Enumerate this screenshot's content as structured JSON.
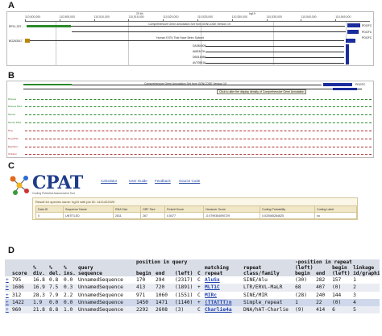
{
  "panels": {
    "a": {
      "letter": "A",
      "ruler": [
        "110,500,000",
        "110,505,000",
        "110,510,000",
        "110,515,000",
        "110,520,000",
        "110,525,000",
        "110,530,000",
        "110,535,000",
        "110,540,000",
        "110,545,000"
      ],
      "scale": "20 kb",
      "scale_label": "hg19",
      "track_title_1": "Comprehensive Gene Annotation Set from GENCODE Version 19",
      "track_title_2": "Human ESTs That Have Been Spliced",
      "gene_left": "RP11-327...",
      "gene_est": "BG263017",
      "labels_right": [
        "PDGFC",
        "PDGFC",
        "PDGFC"
      ],
      "est_labels": [
        "DA384005",
        "AI653476",
        "DB316086",
        "AV705516"
      ]
    },
    "b": {
      "letter": "B",
      "track_title": "Comprehensive Gene Annotation Set from GENCODE Version 19",
      "tooltip": "Click to alter the display density of Comprehensive Gene Annotation",
      "rows": [
        {
          "name": "Rhesus",
          "color": "#2c8a2c"
        },
        {
          "name": "Rhesus RNA",
          "color": "#2c8a2c"
        },
        {
          "name": "Mouse",
          "color": "#2c8a2c"
        },
        {
          "name": "Mouse RNA",
          "color": "#2c8a2c"
        },
        {
          "name": "Dog",
          "color": "#b03030"
        },
        {
          "name": "Dog RNA",
          "color": "#b03030"
        },
        {
          "name": "Elephant",
          "color": "#b03030"
        },
        {
          "name": "Chicken",
          "color": "#b03030"
        }
      ],
      "right_label": "PDGFC"
    },
    "c": {
      "letter": "C",
      "logo": "CPAT",
      "logo_sub": "Coding Potential Assessment Tool",
      "nav": [
        "Calculator",
        "User Guide",
        "Feedback",
        "Source Code"
      ],
      "result_title": "Result for species name: hg19 with job ID: 1421422020",
      "headers": [
        "Data ID",
        "Sequence Name",
        "RNA Size",
        "ORF Size",
        "Fickett Score",
        "Hexamer Score",
        "Coding Probability",
        "Coding Label"
      ],
      "row": [
        "0",
        "UNTITLED",
        "2811",
        "267",
        "0.5477",
        "-0.0799304090729",
        "0.020065284625",
        "no"
      ]
    },
    "d": {
      "letter": "D",
      "headers": {
        "score": "score",
        "div": [
          "%",
          "div."
        ],
        "del": [
          "%",
          "del."
        ],
        "ins": [
          "%",
          "ins."
        ],
        "qseq": [
          "query",
          "sequence"
        ],
        "pos_group": "position in query",
        "begin": "begin",
        "end": "end",
        "left": "(left)",
        "c": "C",
        "matching": [
          "matching",
          "repeat"
        ],
        "class": [
          "repeat",
          "class/family"
        ],
        "rpos_group": "-position in repeat-",
        "rbegin": [
          "(left)",
          "begin"
        ],
        "rend": "end",
        "rleft": [
          "begin",
          "(left)"
        ],
        "linkage": [
          "linkage",
          "id/graphic"
        ]
      },
      "rows": [
        {
          "plus": "+",
          "score": "795",
          "div": "16.8",
          "del": "0.8",
          "ins": "0.0",
          "seq": "UnnamedSequence",
          "begin": "170",
          "end": "294",
          "left": "(2317)",
          "c": "C",
          "repeat": "AluSx",
          "cls": "SINE/Alu",
          "rb": "(30)",
          "re": "282",
          "rl": "157",
          "link": "1"
        },
        {
          "plus": "+",
          "score": "1686",
          "div": "16.9",
          "del": "7.5",
          "ins": "0.3",
          "seq": "UnnamedSequence",
          "begin": "413",
          "end": "720",
          "left": "(1891)",
          "c": "+",
          "repeat": "MLT1C",
          "cls": "LTR/ERVL-MaLR",
          "rb": "68",
          "re": "407",
          "rl": "(0)",
          "link": "2"
        },
        {
          "plus": "+",
          "score": "312",
          "div": "28.3",
          "del": "7.9",
          "ins": "2.2",
          "seq": "UnnamedSequence",
          "begin": "971",
          "end": "1060",
          "left": "(1551)",
          "c": "C",
          "repeat": "MIRc",
          "cls": "SINE/MIR",
          "rb": "(28)",
          "re": "240",
          "rl": "144",
          "link": "3"
        },
        {
          "plus": "+",
          "score": "1422",
          "div": "1.9",
          "del": "0.0",
          "ins": "0.0",
          "seq": "UnnamedSequence",
          "begin": "1450",
          "end": "1471",
          "left": "(1140)",
          "c": "+",
          "repeat": "(TTATTT)n",
          "cls": "Simple_repeat",
          "rb": "1",
          "re": "22",
          "rl": "(0)",
          "link": "4"
        },
        {
          "plus": "+",
          "score": "960",
          "div": "21.8",
          "del": "8.8",
          "ins": "1.0",
          "seq": "UnnamedSequence",
          "begin": "2292",
          "end": "2608",
          "left": "(3)",
          "c": "C",
          "repeat": "Charlie4a",
          "cls": "DNA/hAT-Charlie",
          "rb": "(9)",
          "re": "414",
          "rl": "6",
          "link": "5"
        }
      ]
    }
  }
}
